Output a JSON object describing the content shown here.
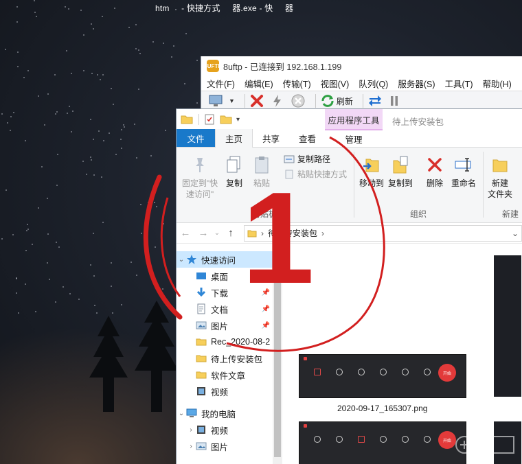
{
  "taskbar": {
    "items": [
      "htm",
      "- 快捷方式",
      "器.exe - 快",
      "器"
    ]
  },
  "ftp": {
    "title": "8uftp - 已连接到 192.168.1.199",
    "logo_text": "8UFTP",
    "menu": [
      "文件(F)",
      "编辑(E)",
      "传输(T)",
      "视图(V)",
      "队列(Q)",
      "服务器(S)",
      "工具(T)",
      "帮助(H)"
    ],
    "refresh_label": "刷新"
  },
  "explorer": {
    "window_title": "待上传安装包",
    "app_tools_label": "应用程序工具",
    "tabs": {
      "file": "文件",
      "home": "主页",
      "share": "共享",
      "view": "查看",
      "manage": "管理"
    },
    "ribbon": {
      "pin_quick": "固定到\"快速访问\"",
      "copy": "复制",
      "paste": "粘贴",
      "copy_path": "复制路径",
      "paste_shortcut": "粘贴快捷方式",
      "clipboard_group": "剪贴板",
      "move_to": "移动到",
      "copy_to": "复制到",
      "delete": "删除",
      "rename": "重命名",
      "organize_group": "组织",
      "new_folder": "新建\n文件夹",
      "new_group": "新建"
    },
    "address": {
      "path": "待上传安装包"
    },
    "nav": {
      "quick_access": "快速访问",
      "items": [
        {
          "label": "桌面",
          "pinned": true
        },
        {
          "label": "下载",
          "pinned": true
        },
        {
          "label": "文档",
          "pinned": true
        },
        {
          "label": "图片",
          "pinned": true
        },
        {
          "label": "Rec_2020-08-2",
          "pinned": false
        },
        {
          "label": "待上传安装包",
          "pinned": false
        },
        {
          "label": "软件文章",
          "pinned": false
        },
        {
          "label": "视频",
          "pinned": false
        }
      ],
      "this_pc": "我的电脑",
      "pc_items": [
        "视频",
        "图片"
      ]
    },
    "files": [
      {
        "name": "2020-09-17_165307.png",
        "start_label": "开始"
      }
    ]
  },
  "annotation": {
    "number": "1"
  },
  "colors": {
    "accent_blue": "#1979ca",
    "app_tools_pink": "#f2d8f6",
    "annotation_red": "#d21f1f",
    "selected_bg": "#cce8ff"
  }
}
